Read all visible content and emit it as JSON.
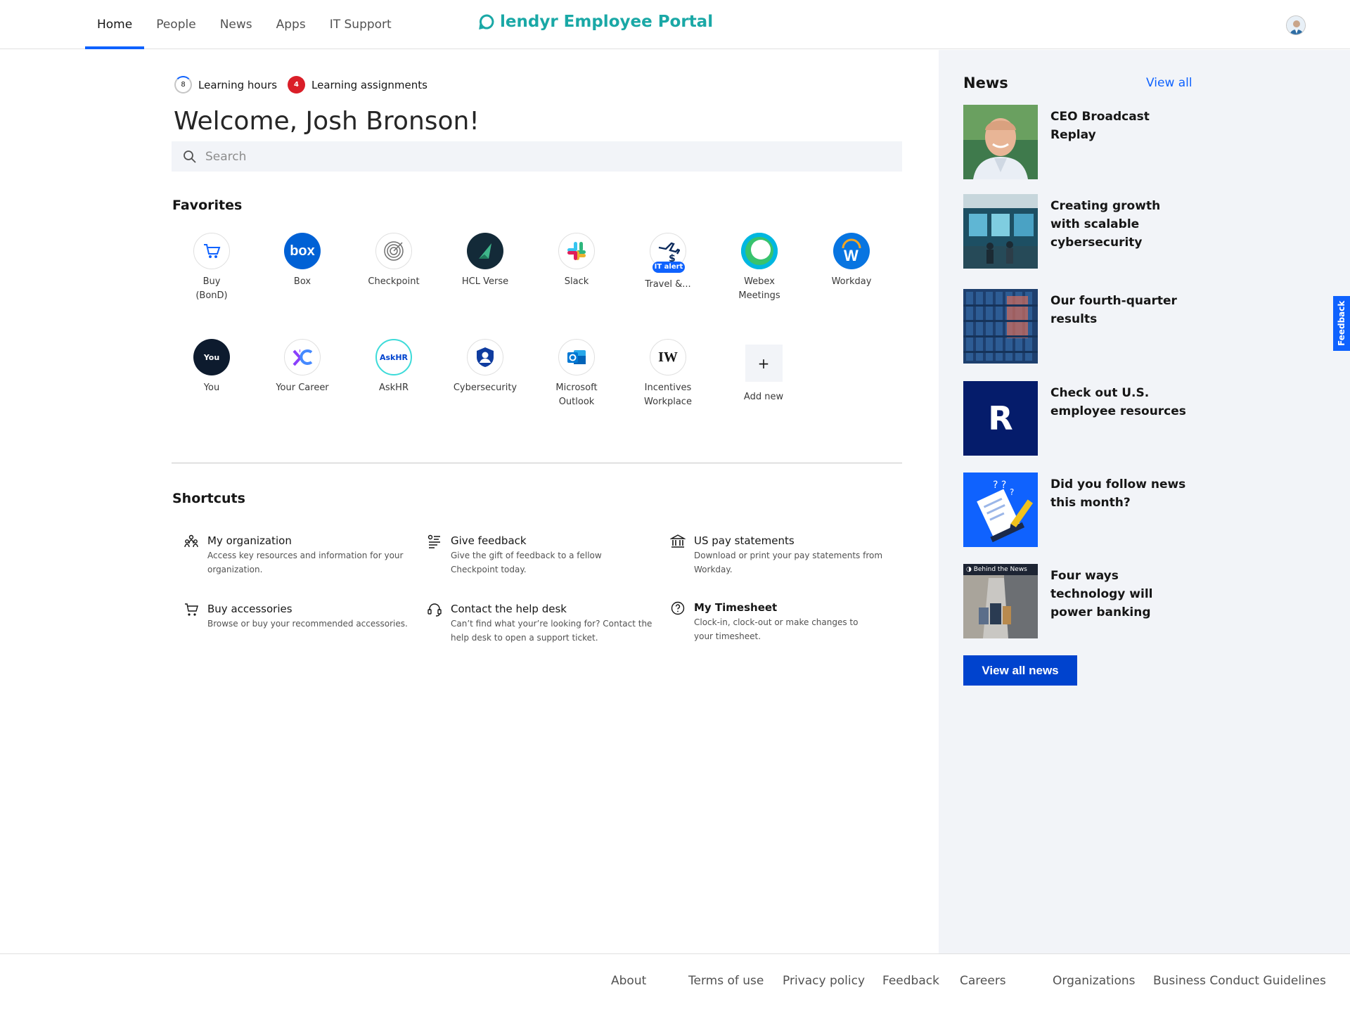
{
  "header": {
    "nav": [
      "Home",
      "People",
      "News",
      "Apps",
      "IT Support"
    ],
    "brand": "lendyr Employee Portal",
    "accent": "#0f62fe",
    "brand_color": "#1aa8a6"
  },
  "learning": {
    "hours_count": "8",
    "hours_label": "Learning hours",
    "assign_count": "4",
    "assign_label": "Learning assignments"
  },
  "welcome": "Welcome, Josh Bronson!",
  "search": {
    "placeholder": "Search"
  },
  "favorites": {
    "title": "Favorites",
    "items": [
      {
        "label": "Buy\n(BonD)",
        "icon": "cart-icon"
      },
      {
        "label": "Box",
        "icon": "box-logo-icon"
      },
      {
        "label": "Checkpoint",
        "icon": "target-icon"
      },
      {
        "label": "HCL Verse",
        "icon": "verse-logo-icon"
      },
      {
        "label": "Slack",
        "icon": "slack-logo-icon"
      },
      {
        "label": "Travel &...",
        "icon": "travel-expense-icon",
        "badge": "IT alert"
      },
      {
        "label": "Webex\nMeetings",
        "icon": "webex-logo-icon"
      },
      {
        "label": "Workday",
        "icon": "workday-logo-icon"
      },
      {
        "label": "You",
        "icon": "you-logo-icon",
        "icon_text": "You"
      },
      {
        "label": "Your Career",
        "icon": "your-career-logo-icon"
      },
      {
        "label": "AskHR",
        "icon": "askhr-logo-icon",
        "icon_text": "AskHR"
      },
      {
        "label": "Cybersecurity",
        "icon": "shield-user-icon"
      },
      {
        "label": "Microsoft\nOutlook",
        "icon": "outlook-logo-icon"
      },
      {
        "label": "Incentives\nWorkplace",
        "icon": "incentives-logo-icon",
        "icon_text": "IW"
      }
    ],
    "add_new": "Add new",
    "add_symbol": "+"
  },
  "shortcuts": {
    "title": "Shortcuts",
    "items": [
      {
        "title": "My organization",
        "desc": "Access key resources and information for your organization.",
        "icon": "org-icon"
      },
      {
        "title": "Give feedback",
        "desc": "Give the gift of feedback to a fellow Checkpoint today.",
        "icon": "feedback-list-icon"
      },
      {
        "title": "US pay statements",
        "desc": "Download or print your pay statements from Workday.",
        "icon": "bank-icon"
      },
      {
        "title": "Buy accessories",
        "desc": "Browse or buy your recommended accessories.",
        "icon": "cart-icon"
      },
      {
        "title": "Contact the help desk",
        "desc": "Can’t find what your’re looking for? Contact the help desk to open a support ticket.",
        "icon": "headset-icon"
      },
      {
        "title": "My Timesheet",
        "desc": "Clock-in, clock-out or make changes to your timesheet.",
        "icon": "help-circle-icon"
      }
    ]
  },
  "news": {
    "title": "News",
    "view_all": "View all",
    "items": [
      {
        "title": "CEO Broadcast Replay",
        "thumb": "portrait"
      },
      {
        "title": "Creating growth with scalable cybersecurity",
        "thumb": "control-room"
      },
      {
        "title": "Our fourth-quarter results",
        "thumb": "building"
      },
      {
        "title": "Check out U.S. employee resources",
        "thumb": "letter",
        "thumb_text": "R"
      },
      {
        "title": "Did you follow news this month?",
        "thumb": "quiz"
      },
      {
        "title": "Four ways technology will power banking",
        "thumb": "shopping",
        "thumb_text": "Behind the News"
      }
    ],
    "button": "View all news"
  },
  "feedback_tab": "Feedback",
  "footer": [
    "About",
    "Terms of use",
    "Privacy policy",
    "Feedback",
    "Careers",
    "Organizations",
    "Business Conduct Guidelines"
  ]
}
